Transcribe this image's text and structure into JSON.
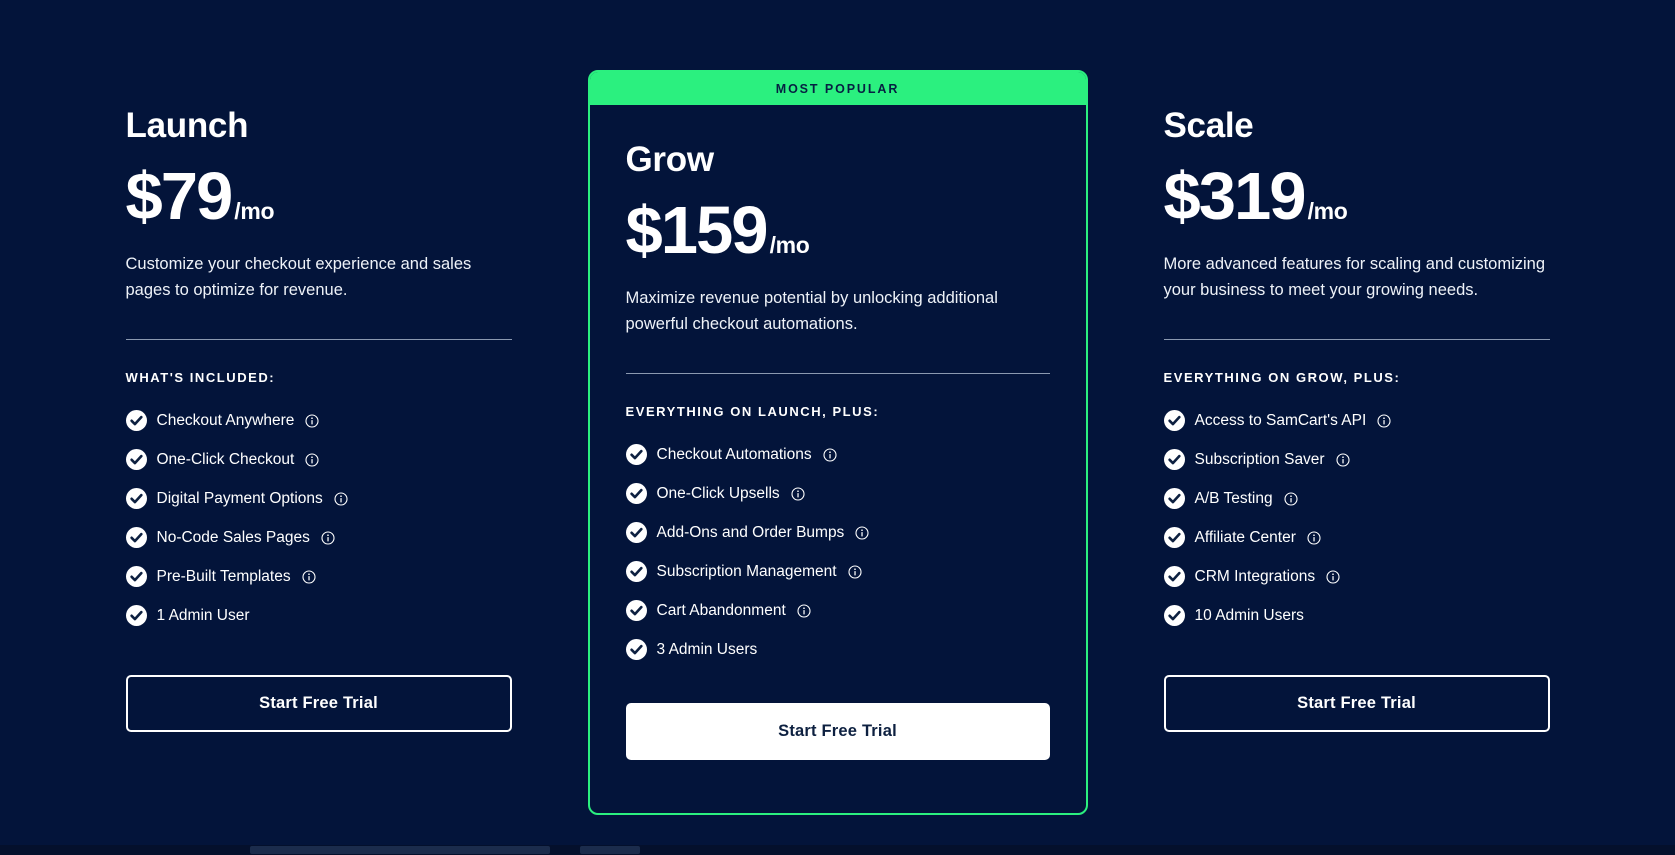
{
  "theme": {
    "background": "#03143a",
    "accent_green": "#2bf07f",
    "text_primary": "#ffffff",
    "featured_button_text": "#0d2040"
  },
  "plans": [
    {
      "name": "Launch",
      "price": "$79",
      "period": "/mo",
      "description": "Customize your checkout experience and sales pages to optimize for revenue.",
      "included_label": "What's included:",
      "features": [
        {
          "label": "Checkout Anywhere",
          "info": true
        },
        {
          "label": "One-Click Checkout",
          "info": true
        },
        {
          "label": "Digital Payment Options",
          "info": true
        },
        {
          "label": "No-Code Sales Pages",
          "info": true
        },
        {
          "label": "Pre-Built Templates",
          "info": true
        },
        {
          "label": "1 Admin User",
          "info": false
        }
      ],
      "cta": "Start Free Trial",
      "featured": false,
      "badge": null
    },
    {
      "name": "Grow",
      "price": "$159",
      "period": "/mo",
      "description": "Maximize revenue potential by unlocking additional powerful checkout automations.",
      "included_label": "Everything on Launch, plus:",
      "features": [
        {
          "label": "Checkout Automations",
          "info": true
        },
        {
          "label": "One-Click Upsells",
          "info": true
        },
        {
          "label": "Add-Ons and Order Bumps",
          "info": true
        },
        {
          "label": "Subscription Management",
          "info": true
        },
        {
          "label": "Cart Abandonment",
          "info": true
        },
        {
          "label": "3 Admin Users",
          "info": false
        }
      ],
      "cta": "Start Free Trial",
      "featured": true,
      "badge": "Most Popular"
    },
    {
      "name": "Scale",
      "price": "$319",
      "period": "/mo",
      "description": "More advanced features for scaling and customizing your business to meet your growing needs.",
      "included_label": "Everything on Grow, plus:",
      "features": [
        {
          "label": "Access to SamCart's API",
          "info": true
        },
        {
          "label": "Subscription Saver",
          "info": true
        },
        {
          "label": "A/B Testing",
          "info": true
        },
        {
          "label": "Affiliate Center",
          "info": true
        },
        {
          "label": "CRM Integrations",
          "info": true
        },
        {
          "label": "10 Admin Users",
          "info": false
        }
      ],
      "cta": "Start Free Trial",
      "featured": false,
      "badge": null
    }
  ]
}
